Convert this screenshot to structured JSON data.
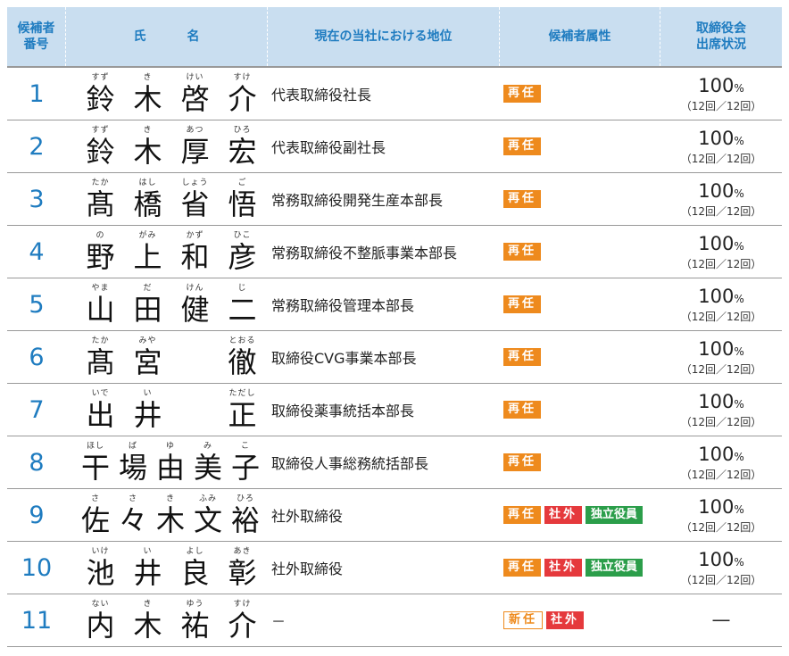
{
  "header": {
    "no": "候補者\n番号",
    "name_1": "氏",
    "name_2": "名",
    "position": "現在の当社における地位",
    "attr": "候補者属性",
    "attendance": "取締役会\n出席状況"
  },
  "rows": [
    {
      "no": "1",
      "chars": [
        {
          "rb": "すず",
          "kj": "鈴"
        },
        {
          "rb": "き",
          "kj": "木"
        },
        {
          "rb": "けい",
          "kj": "啓"
        },
        {
          "rb": "すけ",
          "kj": "介"
        }
      ],
      "position": "代表取締役社長",
      "badges": [
        "再任"
      ],
      "pct": "100",
      "pct_unit": "%",
      "count": "（12回／12回）"
    },
    {
      "no": "2",
      "chars": [
        {
          "rb": "すず",
          "kj": "鈴"
        },
        {
          "rb": "き",
          "kj": "木"
        },
        {
          "rb": "あつ",
          "kj": "厚"
        },
        {
          "rb": "ひろ",
          "kj": "宏"
        }
      ],
      "position": "代表取締役副社長",
      "badges": [
        "再任"
      ],
      "pct": "100",
      "pct_unit": "%",
      "count": "（12回／12回）"
    },
    {
      "no": "3",
      "chars": [
        {
          "rb": "たか",
          "kj": "髙"
        },
        {
          "rb": "はし",
          "kj": "橋"
        },
        {
          "rb": "しょう",
          "kj": "省"
        },
        {
          "rb": "ご",
          "kj": "悟"
        }
      ],
      "position": "常務取締役開発生産本部長",
      "badges": [
        "再任"
      ],
      "pct": "100",
      "pct_unit": "%",
      "count": "（12回／12回）"
    },
    {
      "no": "4",
      "chars": [
        {
          "rb": "の",
          "kj": "野"
        },
        {
          "rb": "がみ",
          "kj": "上"
        },
        {
          "rb": "かず",
          "kj": "和"
        },
        {
          "rb": "ひこ",
          "kj": "彦"
        }
      ],
      "position": "常務取締役不整脈事業本部長",
      "badges": [
        "再任"
      ],
      "pct": "100",
      "pct_unit": "%",
      "count": "（12回／12回）"
    },
    {
      "no": "5",
      "chars": [
        {
          "rb": "やま",
          "kj": "山"
        },
        {
          "rb": "だ",
          "kj": "田"
        },
        {
          "rb": "けん",
          "kj": "健"
        },
        {
          "rb": "じ",
          "kj": "二"
        }
      ],
      "position": "常務取締役管理本部長",
      "badges": [
        "再任"
      ],
      "pct": "100",
      "pct_unit": "%",
      "count": "（12回／12回）"
    },
    {
      "no": "6",
      "chars": [
        {
          "rb": "たか",
          "kj": "髙"
        },
        {
          "rb": "みや",
          "kj": "宮"
        },
        {
          "rb": "",
          "kj": ""
        },
        {
          "rb": "とおる",
          "kj": "徹"
        }
      ],
      "position": "取締役CVG事業本部長",
      "badges": [
        "再任"
      ],
      "pct": "100",
      "pct_unit": "%",
      "count": "（12回／12回）"
    },
    {
      "no": "7",
      "chars": [
        {
          "rb": "いで",
          "kj": "出"
        },
        {
          "rb": "い",
          "kj": "井"
        },
        {
          "rb": "",
          "kj": ""
        },
        {
          "rb": "ただし",
          "kj": "正"
        }
      ],
      "position": "取締役薬事統括本部長",
      "badges": [
        "再任"
      ],
      "pct": "100",
      "pct_unit": "%",
      "count": "（12回／12回）"
    },
    {
      "no": "8",
      "chars": [
        {
          "rb": "ほし",
          "kj": "干"
        },
        {
          "rb": "ば",
          "kj": "場"
        },
        {
          "rb": "ゆ",
          "kj": "由"
        },
        {
          "rb": "み",
          "kj": "美"
        },
        {
          "rb": "こ",
          "kj": "子"
        }
      ],
      "position": "取締役人事総務統括部長",
      "badges": [
        "再任"
      ],
      "pct": "100",
      "pct_unit": "%",
      "count": "（12回／12回）"
    },
    {
      "no": "9",
      "chars": [
        {
          "rb": "さ",
          "kj": "佐"
        },
        {
          "rb": "さ",
          "kj": "々"
        },
        {
          "rb": "き",
          "kj": "木"
        },
        {
          "rb": "ふみ",
          "kj": "文"
        },
        {
          "rb": "ひろ",
          "kj": "裕"
        }
      ],
      "position": "社外取締役",
      "badges": [
        "再任",
        "社外",
        "独立役員"
      ],
      "pct": "100",
      "pct_unit": "%",
      "count": "（12回／12回）"
    },
    {
      "no": "10",
      "chars": [
        {
          "rb": "いけ",
          "kj": "池"
        },
        {
          "rb": "い",
          "kj": "井"
        },
        {
          "rb": "よし",
          "kj": "良"
        },
        {
          "rb": "あき",
          "kj": "彰"
        }
      ],
      "position": "社外取締役",
      "badges": [
        "再任",
        "社外",
        "独立役員"
      ],
      "pct": "100",
      "pct_unit": "%",
      "count": "（12回／12回）"
    },
    {
      "no": "11",
      "chars": [
        {
          "rb": "ない",
          "kj": "内"
        },
        {
          "rb": "き",
          "kj": "木"
        },
        {
          "rb": "ゆう",
          "kj": "祐"
        },
        {
          "rb": "すけ",
          "kj": "介"
        }
      ],
      "position": "－",
      "badges": [
        "新任",
        "社外"
      ],
      "pct": "—",
      "pct_unit": "",
      "count": ""
    }
  ],
  "colors": {
    "accent_blue": "#1f7cc0",
    "header_bg": "#c9def0",
    "saini_orange": "#ee8a1d",
    "shagai_red": "#e5393c",
    "independent_green": "#2b9e4a"
  }
}
